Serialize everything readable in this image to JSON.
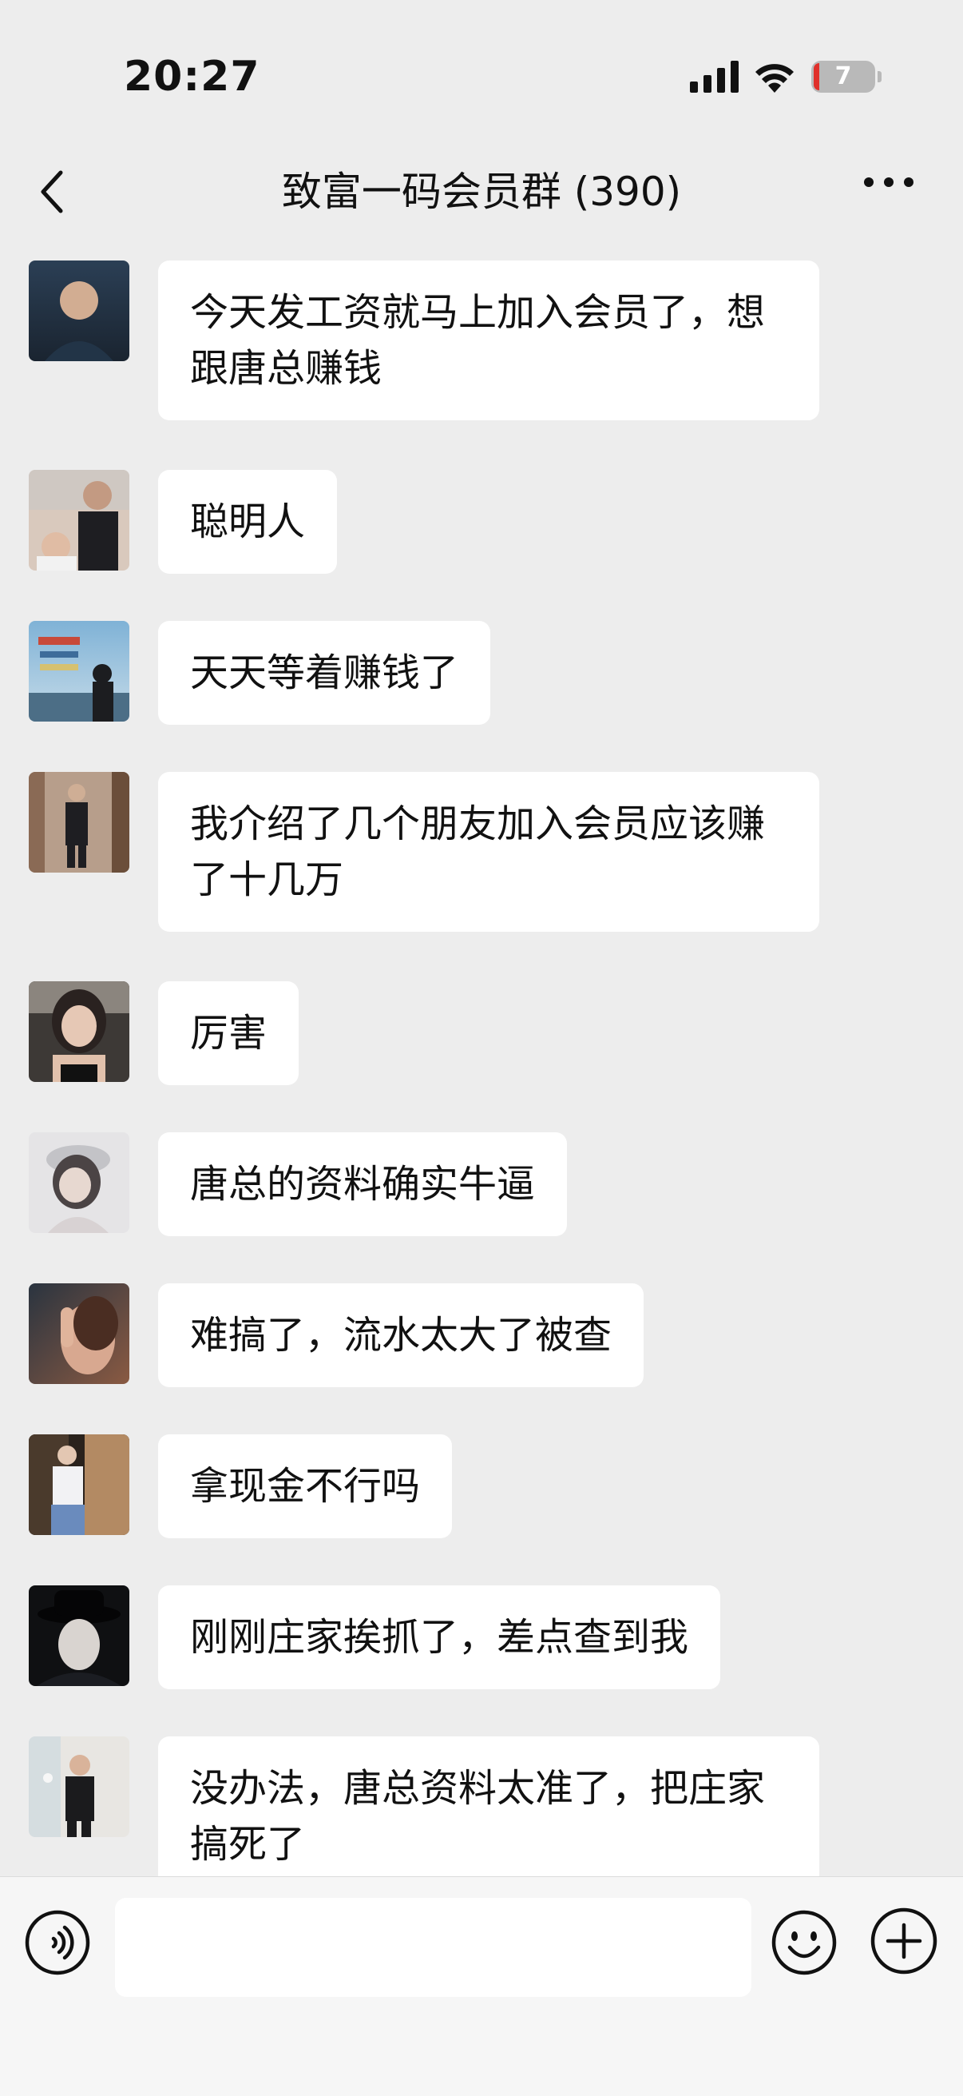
{
  "status_bar": {
    "time": "20:27",
    "battery_level": "7",
    "battery_color": "#e0302b"
  },
  "nav": {
    "title": "致富一码会员群 (390)",
    "back_icon": "chevron-left-icon",
    "more_icon": "more-dots-icon"
  },
  "messages": [
    {
      "text": "今天发工资就马上加入会员了，想跟唐总赚钱",
      "avatar_colors": [
        "#2b3f55",
        "#1a2430"
      ]
    },
    {
      "text": "聪明人",
      "avatar_colors": [
        "#6e6a66",
        "#d9c9bd"
      ]
    },
    {
      "text": "天天等着赚钱了",
      "avatar_colors": [
        "#7fb2d6",
        "#2d3947"
      ]
    },
    {
      "text": "我介绍了几个朋友加入会员应该赚了十几万",
      "avatar_colors": [
        "#6b4e3a",
        "#1e1e22"
      ]
    },
    {
      "text": "厉害",
      "avatar_colors": [
        "#3d3936",
        "#d7b9a3"
      ]
    },
    {
      "text": "唐总的资料确实牛逼",
      "avatar_colors": [
        "#bfbfc3",
        "#4b4445"
      ]
    },
    {
      "text": "难搞了，流水太大了被查",
      "avatar_colors": [
        "#8a5a42",
        "#d8a890"
      ]
    },
    {
      "text": "拿现金不行吗",
      "avatar_colors": [
        "#2a221c",
        "#b38a63"
      ]
    },
    {
      "text": "刚刚庄家挨抓了，差点查到我",
      "avatar_colors": [
        "#0f1012",
        "#3a3f49"
      ]
    },
    {
      "text": "没办法，唐总资料太准了，把庄家搞死了",
      "avatar_colors": [
        "#e8e6e2",
        "#1b1b1d"
      ]
    }
  ],
  "input_bar": {
    "voice_icon": "voice-icon",
    "emoji_icon": "emoji-icon",
    "plus_icon": "plus-icon",
    "placeholder": ""
  }
}
